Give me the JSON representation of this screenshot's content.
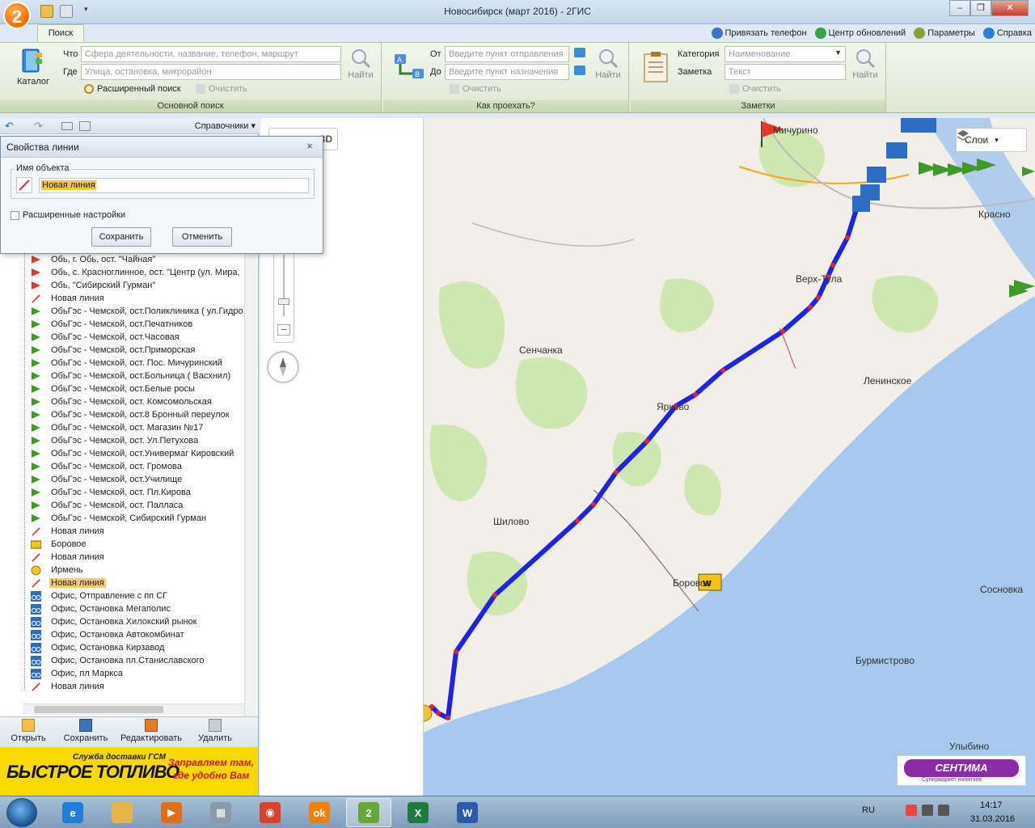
{
  "window": {
    "title": "Новосибирск (март 2016) - 2ГИС",
    "logo_text": "2",
    "controls": [
      "–",
      "❐",
      "✕"
    ]
  },
  "ribbon": {
    "active_tab": "Поиск",
    "top_links": [
      "Привязать телефон",
      "Центр обновлений",
      "Параметры",
      "Справка"
    ],
    "catalog_label": "Каталог",
    "search": {
      "what_label": "Что",
      "what_placeholder": "Сфера деятельности, название, телефон, маршрут",
      "where_label": "Где",
      "where_placeholder": "Улица, остановка, микрорайон",
      "advanced_label": "Расширенный поиск",
      "clear_label": "Очистить",
      "find_label": "Найти",
      "group_title": "Основной поиск"
    },
    "route": {
      "from_label": "От",
      "from_placeholder": "Введите пункт отправления",
      "to_label": "До",
      "to_placeholder": "Введите пункт назначения",
      "clear_label": "Очистить",
      "find_label": "Найти",
      "group_title": "Как проехать?"
    },
    "notes": {
      "category_label": "Категория",
      "category_placeholder": "Наименование",
      "note_label": "Заметка",
      "note_placeholder": "Текст",
      "clear_label": "Очистить",
      "find_label": "Найти",
      "group_title": "Заметки"
    }
  },
  "left_toolbar": {
    "directories_label": "Справочники"
  },
  "dialog": {
    "title": "Свойства линии",
    "close": "×",
    "group_label": "Имя объекта",
    "name_value": "Новая линия",
    "advanced_label": "Расширенные настройки",
    "advanced_checked": false,
    "save_label": "Сохранить",
    "cancel_label": "Отменить"
  },
  "tree": [
    {
      "icon": "flag-red",
      "label": "Обь, г. Обь, ост. \"Чайная\""
    },
    {
      "icon": "flag-red",
      "label": "Обь, с. Красноглинное, ост. \"Центр (ул. Мира,"
    },
    {
      "icon": "flag-red",
      "label": "Обь, \"Сибирский Гурман\""
    },
    {
      "icon": "line",
      "label": "Новая линия"
    },
    {
      "icon": "flag-green",
      "label": "ОбьГэс - Чемской,  ост.Поликлиника ( ул.Гидро"
    },
    {
      "icon": "flag-green",
      "label": "ОбьГэс - Чемской, ост.Печатников"
    },
    {
      "icon": "flag-green",
      "label": "ОбьГэс - Чемской, ост.Часовая"
    },
    {
      "icon": "flag-green",
      "label": "ОбьГэс - Чемской, ост.Приморская"
    },
    {
      "icon": "flag-green",
      "label": "ОбьГэс - Чемской, ост. Пос. Мичуринский"
    },
    {
      "icon": "flag-green",
      "label": "ОбьГэс - Чемской, ост.Больница ( Васхнил)"
    },
    {
      "icon": "flag-green",
      "label": "ОбьГэс - Чемской, ост.Белые росы"
    },
    {
      "icon": "flag-green",
      "label": "ОбьГэс - Чемской, ост. Комсомольская"
    },
    {
      "icon": "flag-green",
      "label": "ОбьГэс - Чемской, ост.8 Бронный переулок"
    },
    {
      "icon": "flag-green",
      "label": "ОбьГэс - Чемской, ост. Магазин №17"
    },
    {
      "icon": "flag-green",
      "label": "ОбьГэс - Чемской, ост. Ул.Петухова"
    },
    {
      "icon": "flag-green",
      "label": "ОбьГэс - Чемской, ост.Универмаг Кировский"
    },
    {
      "icon": "flag-green",
      "label": "ОбьГэс - Чемской, ост. Громова"
    },
    {
      "icon": "flag-green",
      "label": "ОбьГэс - Чемской, ост.Училище"
    },
    {
      "icon": "flag-green",
      "label": "ОбьГэс - Чемской, ост. Пл.Кирова"
    },
    {
      "icon": "flag-green",
      "label": "ОбьГэс - Чемской, ост. Палласа"
    },
    {
      "icon": "flag-green",
      "label": "ОбьГэс - Чемской, Сибирский Гурман"
    },
    {
      "icon": "line",
      "label": "Новая линия"
    },
    {
      "icon": "taxi",
      "label": "Боровое"
    },
    {
      "icon": "line",
      "label": "Новая линия"
    },
    {
      "icon": "coin",
      "label": "Ирмень"
    },
    {
      "icon": "line",
      "label": "Новая линия",
      "selected": true
    },
    {
      "icon": "bike",
      "label": "Офис, Отправление с пп СГ"
    },
    {
      "icon": "bike",
      "label": "Офис, Остановка Мегаполис"
    },
    {
      "icon": "bike",
      "label": "Офис, Остановка Хилокский рынок"
    },
    {
      "icon": "bike",
      "label": "Офис, Остановка Автокомбинат"
    },
    {
      "icon": "bike",
      "label": "Офис, Остановка Кирзавод"
    },
    {
      "icon": "bike",
      "label": "Офис, Остановка пл.Станиславского"
    },
    {
      "icon": "bike",
      "label": "Офис, пл Маркса"
    },
    {
      "icon": "line",
      "label": "Новая линия"
    }
  ],
  "left_actions": [
    "Открыть",
    "Сохранить",
    "Редактировать",
    "Удалить"
  ],
  "ad": {
    "top": "Служба доставки ГСМ",
    "brand": "БЫСТРОЕ ТОПЛИВО",
    "slogan_1": "Заправляем там,",
    "slogan_2": "где удобно Вам"
  },
  "map": {
    "view_3d": "3D",
    "layers_label": "Слои",
    "labels": [
      "Сенчанка",
      "Верх-Тула",
      "Ленинское",
      "Ярково",
      "Шилово",
      "Боровое",
      "Сосновка",
      "Бурмистрово",
      "Улыбино",
      "Красно",
      "Мичурино"
    ],
    "centum_brand": "СЕНТИМА",
    "centum_sub": "Супермаркет напитков"
  },
  "taskbar": {
    "apps": [
      "ie",
      "explorer",
      "media",
      "calculator",
      "chrome",
      "ok",
      "2gis",
      "excel",
      "word"
    ],
    "lang": "RU",
    "time": "14:17",
    "date": "31.03.2016"
  }
}
